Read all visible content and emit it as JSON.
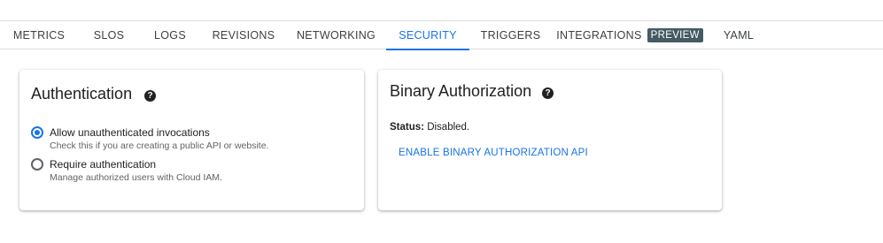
{
  "tabs": [
    {
      "label": "METRICS"
    },
    {
      "label": "SLOS"
    },
    {
      "label": "LOGS"
    },
    {
      "label": "REVISIONS"
    },
    {
      "label": "NETWORKING"
    },
    {
      "label": "SECURITY",
      "active": true
    },
    {
      "label": "TRIGGERS"
    },
    {
      "label": "INTEGRATIONS",
      "badge": "PREVIEW"
    },
    {
      "label": "YAML"
    }
  ],
  "authentication": {
    "title": "Authentication",
    "help_icon": "help-icon",
    "options": [
      {
        "label": "Allow unauthenticated invocations",
        "description": "Check this if you are creating a public API or website.",
        "selected": true
      },
      {
        "label": "Require authentication",
        "description": "Manage authorized users with Cloud IAM.",
        "selected": false
      }
    ]
  },
  "binary_authorization": {
    "title": "Binary Authorization",
    "help_icon": "help-icon",
    "status_label": "Status:",
    "status_value": "Disabled.",
    "enable_link": "ENABLE BINARY AUTHORIZATION API"
  },
  "colors": {
    "accent": "#1a73e8",
    "badge": "#455a64"
  }
}
